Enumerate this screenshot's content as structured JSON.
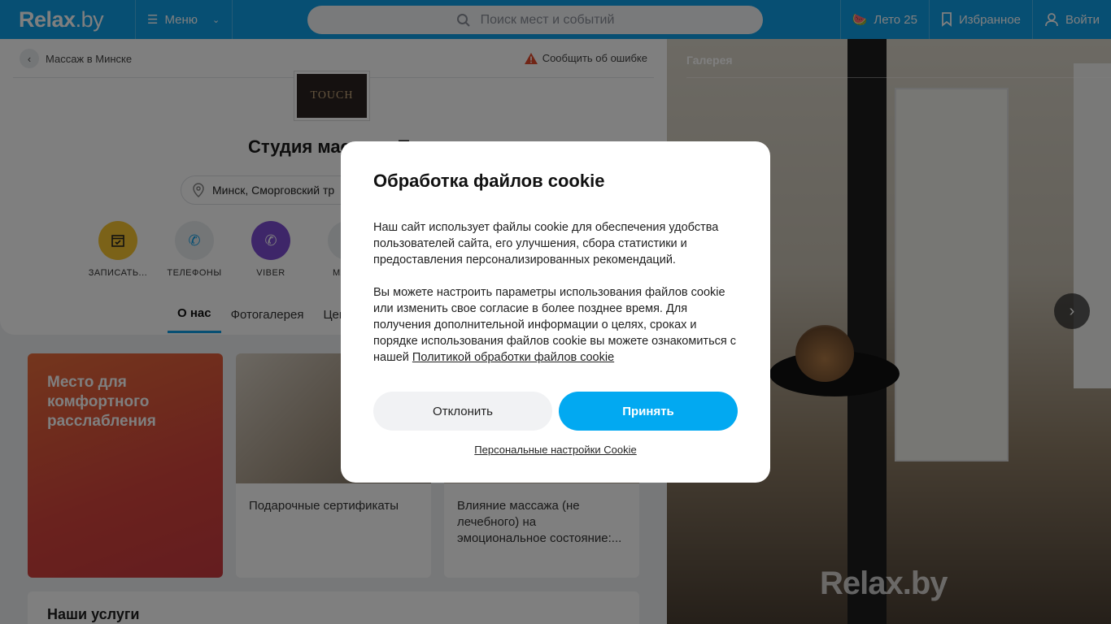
{
  "header": {
    "logo_main": "Relax",
    "logo_suffix": ".by",
    "menu_label": "Меню",
    "search_placeholder": "Поиск мест и событий",
    "summer_label": "Лето 25",
    "favorites_label": "Избранное",
    "login_label": "Войти"
  },
  "breadcrumb": {
    "back_label": "Массаж в Минске"
  },
  "report_label": "Сообщить об ошибке",
  "business": {
    "logo_text": "TOUCH",
    "title": "Студия массажа To",
    "address": "Минск, Сморговский тр"
  },
  "actions": [
    {
      "label": "ЗАПИСАТЬ...",
      "icon": "calendar-icon",
      "color": "#f6c530"
    },
    {
      "label": "ТЕЛЕФОНЫ",
      "icon": "phone-icon",
      "color": "#e9ecef"
    },
    {
      "label": "VIBER",
      "icon": "viber-icon",
      "color": "#7d4dd2"
    },
    {
      "label": "МАРШ",
      "icon": "route-icon",
      "color": "#e9ecef"
    }
  ],
  "tabs": [
    "О нас",
    "Фотогалерея",
    "Цен"
  ],
  "promo": {
    "text": "Место для комфортного расслабления"
  },
  "news": [
    {
      "title": "Подарочные сертификаты"
    },
    {
      "title": "Влияние массажа (не лечебного) на эмоциональное состояние:..."
    }
  ],
  "services": {
    "title": "Наши услуги"
  },
  "gallery": {
    "label": "Галерея",
    "watermark": "Relax.by",
    "next_label": "›"
  },
  "cookie_modal": {
    "title": "Обработка файлов cookie",
    "paragraph1": "Наш сайт использует файлы cookie для обеспечения удобства пользователей сайта, его улучшения, сбора статистики и предоставления персонализированных рекомендаций.",
    "paragraph2": "Вы можете настроить параметры использования файлов cookie или изменить свое согласие в более позднее время. Для получения дополнительной информации о целях, сроках и порядке использования файлов cookie вы можете ознакомиться с нашей",
    "policy_link": "Политикой обработки файлов cookie",
    "decline_label": "Отклонить",
    "accept_label": "Принять",
    "settings_label": "Персональные настройки Cookie"
  }
}
